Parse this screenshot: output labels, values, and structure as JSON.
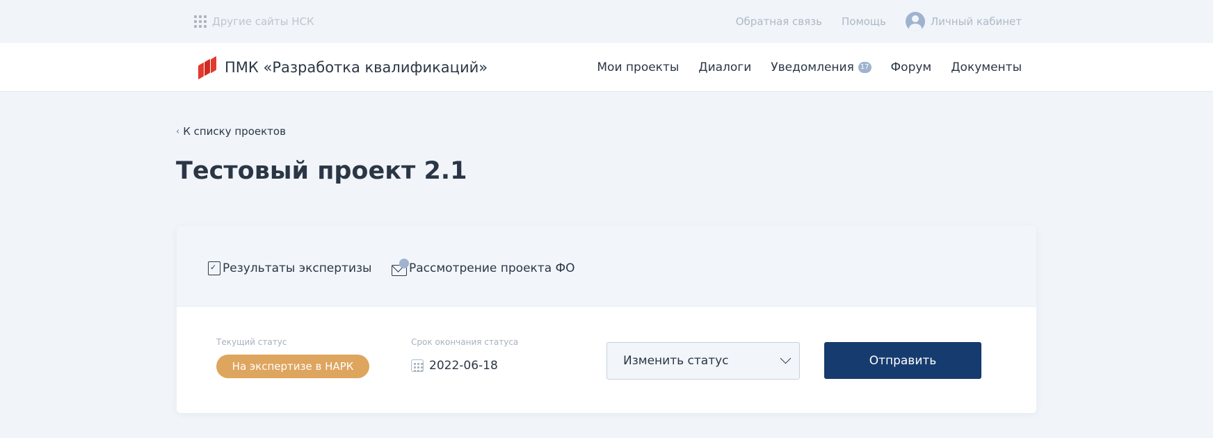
{
  "topbar": {
    "other_sites": "Другие сайты НСК",
    "feedback": "Обратная связь",
    "help": "Помощь",
    "cabinet": "Личный кабинет"
  },
  "header": {
    "brand": "ПМК «Разработка квалификаций»",
    "nav": {
      "projects": "Мои проекты",
      "dialogs": "Диалоги",
      "notifications": "Уведомления",
      "notifications_count": "17",
      "forum": "Форум",
      "documents": "Документы"
    }
  },
  "breadcrumb": "К списку проектов",
  "page_title": "Тестовый проект 2.1",
  "tabs": [
    {
      "label": "Результаты экспертизы",
      "icon": "document-check-icon"
    },
    {
      "label": "Рассмотрение проекта ФО",
      "icon": "envelope-icon"
    }
  ],
  "status": {
    "current_label": "Текущий статус",
    "current_value": "На экспертизе в НАРК",
    "deadline_label": "Срок окончания статуса",
    "deadline_value": "2022-06-18",
    "change_placeholder": "Изменить статус",
    "send_label": "Отправить"
  },
  "colors": {
    "brand": "#e23a2e",
    "status_pill": "#dea55e",
    "primary_button": "#163b6e",
    "badge": "#9fb3cf"
  }
}
